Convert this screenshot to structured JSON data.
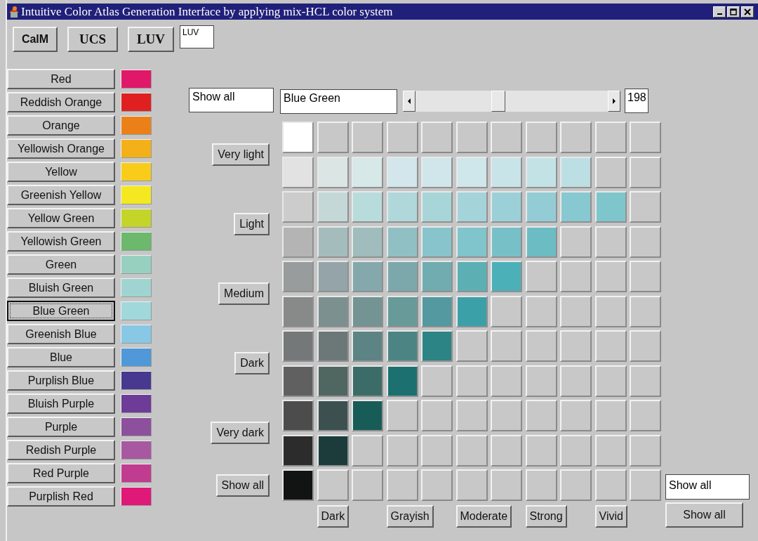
{
  "window": {
    "title": "Intuitive Color Atlas Generation Interface by applying mix-HCL color system"
  },
  "toolbar": {
    "buttons": [
      "CalM",
      "UCS",
      "LUV"
    ],
    "field": "LUV"
  },
  "hues": [
    {
      "label": "Red",
      "color": "#e0186a",
      "selected": false
    },
    {
      "label": "Reddish Orange",
      "color": "#e02020",
      "selected": false
    },
    {
      "label": "Orange",
      "color": "#ec8018",
      "selected": false
    },
    {
      "label": "Yellowish Orange",
      "color": "#f4b018",
      "selected": false
    },
    {
      "label": "Yellow",
      "color": "#f8cc18",
      "selected": false
    },
    {
      "label": "Greenish Yellow",
      "color": "#f4e820",
      "selected": false
    },
    {
      "label": "Yellow Green",
      "color": "#c4d428",
      "selected": false
    },
    {
      "label": "Yellowish Green",
      "color": "#6cb86c",
      "selected": false
    },
    {
      "label": "Green",
      "color": "#98d0c0",
      "selected": false
    },
    {
      "label": "Bluish Green",
      "color": "#a0d4d0",
      "selected": false
    },
    {
      "label": "Blue Green",
      "color": "#a0d8dc",
      "selected": true
    },
    {
      "label": "Greenish Blue",
      "color": "#88c8e4",
      "selected": false
    },
    {
      "label": "Blue",
      "color": "#5098d8",
      "selected": false
    },
    {
      "label": "Purplish Blue",
      "color": "#483890",
      "selected": false
    },
    {
      "label": "Bluish Purple",
      "color": "#6c3c98",
      "selected": false
    },
    {
      "label": "Purple",
      "color": "#8c509c",
      "selected": false
    },
    {
      "label": "Redish Purple",
      "color": "#a858a0",
      "selected": false
    },
    {
      "label": "Red Purple",
      "color": "#c03c90",
      "selected": false
    },
    {
      "label": "Purplish Red",
      "color": "#e01878",
      "selected": false
    }
  ],
  "hue_bar": {
    "filter": "Show all",
    "name": "Blue Green",
    "slider": {
      "level": 0.43
    },
    "angle": "198"
  },
  "lightness_buttons": [
    "Very light",
    "Light",
    "Medium",
    "Dark",
    "Very dark",
    "Show all"
  ],
  "grid": {
    "rows": [
      {
        "chips": [
          {
            "color": "#ffffff"
          }
        ]
      },
      {
        "chips": [
          {
            "color": "#e2e2e2"
          },
          {
            "color": "#dbe6e4"
          },
          {
            "color": "#d6e8e8"
          },
          {
            "color": "#d2e6ec"
          },
          {
            "color": "#d0e6ea"
          },
          {
            "color": "#cfe6ea"
          },
          {
            "color": "#c8e4e8"
          },
          {
            "color": "#c2e2e6"
          },
          {
            "color": "#bcdfe4"
          }
        ]
      },
      {
        "chips": [
          {
            "color": "#cccccc"
          },
          {
            "color": "#c4d8d8"
          },
          {
            "color": "#b8dcdc"
          },
          {
            "color": "#b0d8da"
          },
          {
            "color": "#a8d6d8"
          },
          {
            "color": "#a4d4da"
          },
          {
            "color": "#9cd0d8"
          },
          {
            "color": "#94ccd6"
          },
          {
            "color": "#88c8d0"
          },
          {
            "color": "#7ec6cc"
          }
        ]
      },
      {
        "chips": [
          {
            "color": "#b4b4b4"
          },
          {
            "color": "#a4bcbc"
          },
          {
            "color": "#a0bcbc"
          },
          {
            "color": "#90c0c4"
          },
          {
            "color": "#88c4cc"
          },
          {
            "color": "#80c4cc"
          },
          {
            "color": "#78c0c8"
          },
          {
            "color": "#6cbcc4"
          }
        ]
      },
      {
        "chips": [
          {
            "color": "#989c9c"
          },
          {
            "color": "#94a4a8"
          },
          {
            "color": "#84a8ac"
          },
          {
            "color": "#7ca8ac"
          },
          {
            "color": "#70acb0"
          },
          {
            "color": "#5cb0b4"
          },
          {
            "color": "#4cb0b8"
          }
        ]
      },
      {
        "chips": [
          {
            "color": "#888a8a"
          },
          {
            "color": "#7c9090"
          },
          {
            "color": "#749494"
          },
          {
            "color": "#689a9a"
          },
          {
            "color": "#5498a0"
          },
          {
            "color": "#3ca0a8"
          }
        ]
      },
      {
        "chips": [
          {
            "color": "#747878"
          },
          {
            "color": "#6c7878"
          },
          {
            "color": "#5c8484"
          },
          {
            "color": "#4c8484"
          },
          {
            "color": "#2c8484"
          }
        ]
      },
      {
        "chips": [
          {
            "color": "#606060"
          },
          {
            "color": "#506660"
          },
          {
            "color": "#3c6c68"
          },
          {
            "color": "#1c7070"
          }
        ]
      },
      {
        "chips": [
          {
            "color": "#4c4c4c"
          },
          {
            "color": "#3c5050"
          },
          {
            "color": "#185c58"
          }
        ]
      },
      {
        "chips": [
          {
            "color": "#2c2c2c"
          },
          {
            "color": "#1c3c3c"
          }
        ]
      },
      {
        "chips": [
          {
            "color": "#121414"
          }
        ]
      }
    ]
  },
  "chroma_buttons": [
    "Dark",
    "Grayish",
    "Moderate",
    "Strong",
    "Vivid"
  ],
  "chroma_filter": "Show all",
  "chroma_show_all_button": "Show all"
}
